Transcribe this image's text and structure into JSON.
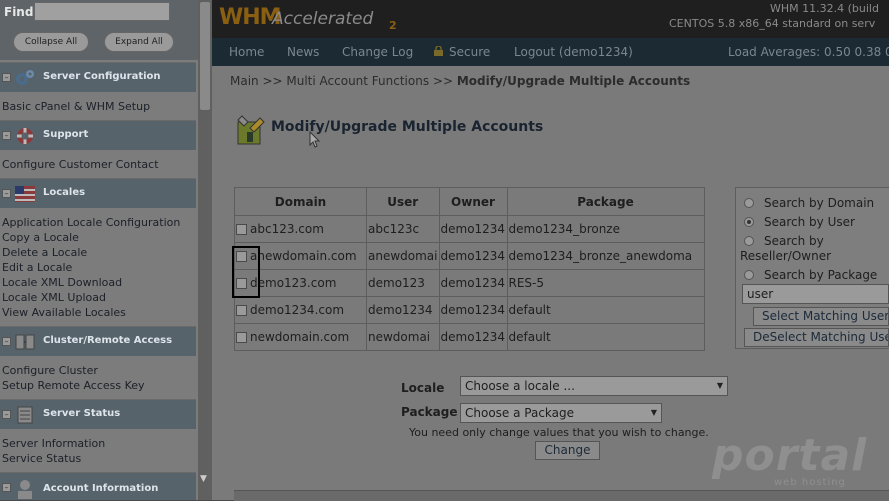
{
  "sidebar": {
    "find_label": "Find",
    "find_value": "",
    "collapse_all": "Collapse All",
    "expand_all": "Expand All",
    "groups": [
      {
        "title": "Server Configuration",
        "icon": "gears-icon",
        "links": [
          "Basic cPanel & WHM Setup"
        ]
      },
      {
        "title": "Support",
        "icon": "lifebuoy-icon",
        "links": [
          "Configure Customer Contact"
        ]
      },
      {
        "title": "Locales",
        "icon": "flag-icon",
        "links": [
          "Application Locale Configuration",
          "Copy a Locale",
          "Delete a Locale",
          "Edit a Locale",
          "Locale XML Download",
          "Locale XML Upload",
          "View Available Locales"
        ]
      },
      {
        "title": "Cluster/Remote Access",
        "icon": "cluster-icon",
        "links": [
          "Configure Cluster",
          "Setup Remote Access Key"
        ]
      },
      {
        "title": "Server Status",
        "icon": "server-icon",
        "links": [
          "Server Information",
          "Service Status"
        ]
      },
      {
        "title": "Account Information",
        "icon": "account-icon",
        "links": []
      }
    ]
  },
  "header": {
    "logo_whm": "WHM",
    "logo_accelerated": "Accelerated",
    "logo_two": "2",
    "version_line1": "WHM 11.32.4 (build",
    "version_line2": "CENTOS 5.8 x86_64 standard on serv"
  },
  "nav": {
    "home": "Home",
    "news": "News",
    "changelog": "Change Log",
    "secure": "Secure",
    "logout": "Logout (demo1234)",
    "load_averages": "Load Averages: 0.50 0.38 0"
  },
  "breadcrumb": {
    "part1": "Main >> Multi Account Functions >> ",
    "current": "Modify/Upgrade Multiple Accounts"
  },
  "page": {
    "title": "Modify/Upgrade Multiple Accounts"
  },
  "table": {
    "headers": [
      "Domain",
      "User",
      "Owner",
      "Package"
    ],
    "rows": [
      {
        "domain": "abc123.com",
        "user": "abc123c",
        "owner": "demo1234",
        "package": "demo1234_bronze"
      },
      {
        "domain": "anewdomain.com",
        "user": "anewdomai",
        "owner": "demo1234",
        "package": "demo1234_bronze_anewdoma"
      },
      {
        "domain": "demo123.com",
        "user": "demo123",
        "owner": "demo1234",
        "package": "RES-5"
      },
      {
        "domain": "demo1234.com",
        "user": "demo1234",
        "owner": "demo1234",
        "package": "default"
      },
      {
        "domain": "newdomain.com",
        "user": "newdomai",
        "owner": "demo1234",
        "package": "default"
      }
    ]
  },
  "search_panel": {
    "by_domain": "Search by Domain",
    "by_user": "Search by User",
    "by_reseller_1": "Search by",
    "by_reseller_2": "Reseller/Owner",
    "by_package": "Search by Package",
    "selected": "user",
    "input_value": "user",
    "select_matching": "Select Matching Users",
    "deselect_matching": "DeSelect Matching User"
  },
  "form": {
    "locale_label": "Locale",
    "locale_value": "Choose a locale ...",
    "package_label": "Package",
    "package_value": "Choose a Package",
    "hint": "You need only change values that you wish to change.",
    "change_button": "Change"
  },
  "watermark": {
    "brand": "portal",
    "tagline": "web hosting"
  }
}
